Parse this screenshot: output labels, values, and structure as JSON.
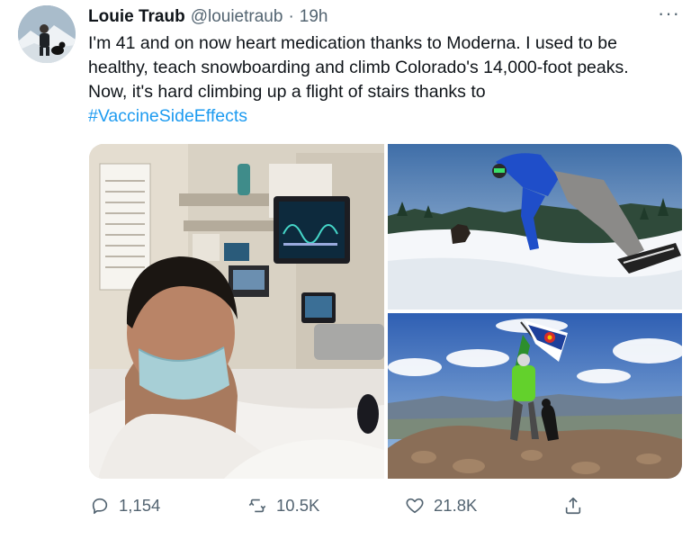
{
  "tweet": {
    "author_name": "Louie Traub",
    "handle": "@louietraub",
    "separator": "·",
    "time": "19h",
    "more_label": "···",
    "text_lines": [
      "I'm 41 and on now heart medication thanks to Moderna. I used to be",
      "healthy, teach snowboarding and climb Colorado's 14,000-foot peaks.",
      "Now, it's hard climbing up a flight of stairs thanks to"
    ],
    "hashtag": "#VaccineSideEffects"
  },
  "media": {
    "photos": [
      "hospital-selfie",
      "snowboarding-jump",
      "mountain-summit-flag"
    ]
  },
  "actions": {
    "replies": "1,154",
    "retweets": "10.5K",
    "likes": "21.8K"
  },
  "icons": {
    "reply": "speech-bubble",
    "retweet": "retweet-arrows",
    "like": "heart",
    "share": "upload-arrow"
  },
  "colors": {
    "accent": "#1d9bf0",
    "secondary_text": "#536471",
    "primary_text": "#0f1419"
  }
}
